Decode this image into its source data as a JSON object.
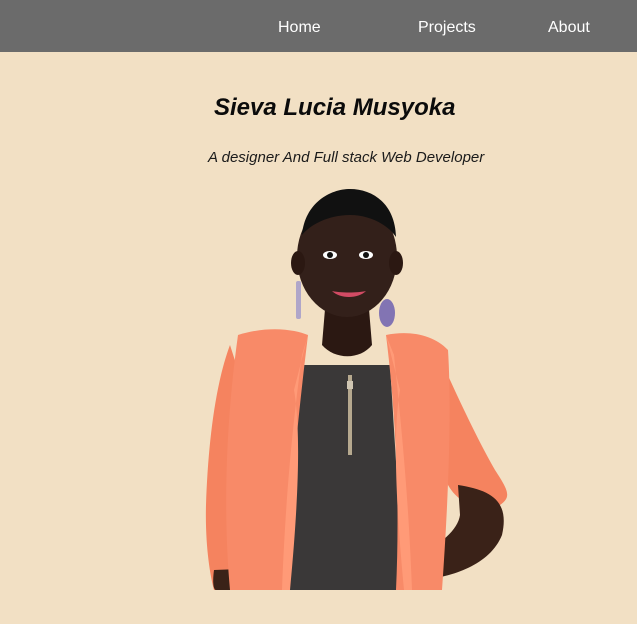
{
  "nav": {
    "home": "Home",
    "projects": "Projects",
    "about": "About"
  },
  "hero": {
    "name": "Sieva Lucia Musyoka",
    "tagline": "A designer And Full stack Web Developer"
  },
  "colors": {
    "page_background": "#f2e0c4",
    "nav_background": "#6b6b6b",
    "nav_text": "#ffffff",
    "jacket": "#f88a68",
    "top": "#3a3838"
  }
}
